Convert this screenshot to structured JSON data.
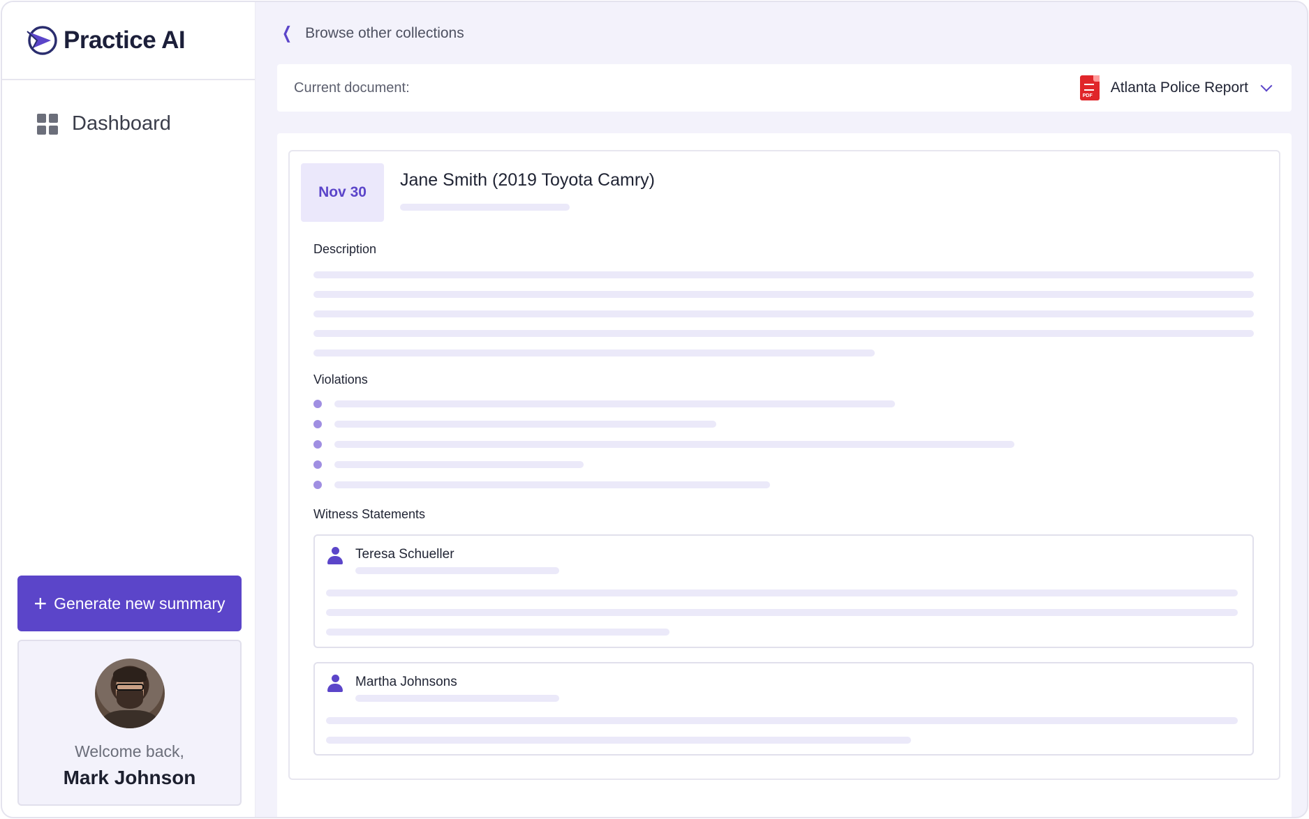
{
  "app": {
    "brand": "Practice AI",
    "brand_color": "#5b45c9"
  },
  "sidebar": {
    "nav": [
      {
        "label": "Dashboard",
        "icon": "dashboard-grid-icon"
      }
    ],
    "generate_button": {
      "label": "Generate new summary",
      "icon": "plus-icon"
    },
    "profile": {
      "welcome": "Welcome back,",
      "name": "Mark Johnson"
    }
  },
  "main": {
    "back_link": "Browse other collections",
    "current_document": {
      "label": "Current document:",
      "value": "Atlanta Police Report",
      "icon": "pdf-file-icon"
    },
    "report": {
      "date": "Nov 30",
      "title": "Jane Smith (2019 Toyota Camry)",
      "sections": {
        "description": "Description",
        "violations": "Violations",
        "witness_statements": "Witness Statements"
      },
      "witnesses": [
        {
          "name": "Teresa Schueller"
        },
        {
          "name": "Martha Johnsons"
        }
      ]
    }
  }
}
